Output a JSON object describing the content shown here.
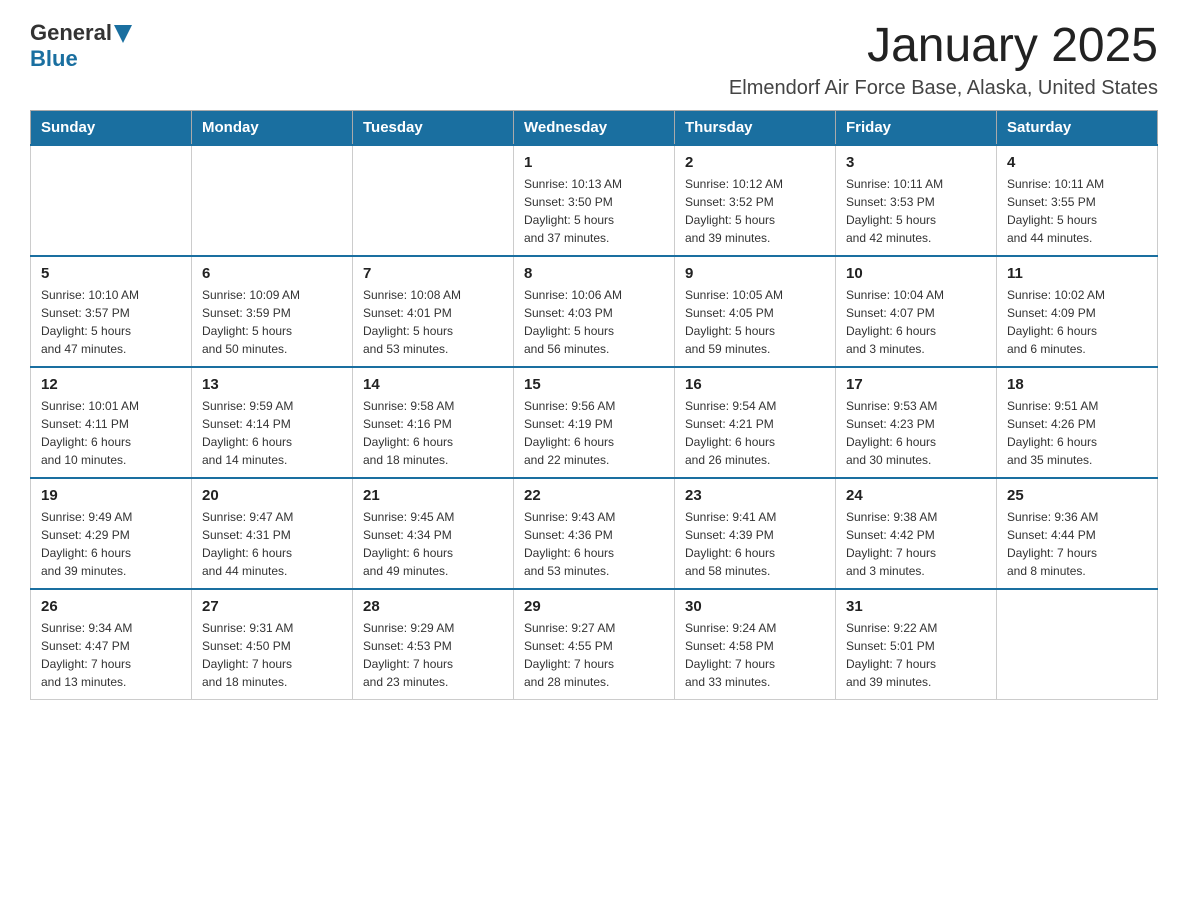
{
  "header": {
    "logo_general": "General",
    "logo_blue": "Blue",
    "month_title": "January 2025",
    "location": "Elmendorf Air Force Base, Alaska, United States"
  },
  "days_of_week": [
    "Sunday",
    "Monday",
    "Tuesday",
    "Wednesday",
    "Thursday",
    "Friday",
    "Saturday"
  ],
  "weeks": [
    [
      {
        "day": "",
        "info": ""
      },
      {
        "day": "",
        "info": ""
      },
      {
        "day": "",
        "info": ""
      },
      {
        "day": "1",
        "info": "Sunrise: 10:13 AM\nSunset: 3:50 PM\nDaylight: 5 hours\nand 37 minutes."
      },
      {
        "day": "2",
        "info": "Sunrise: 10:12 AM\nSunset: 3:52 PM\nDaylight: 5 hours\nand 39 minutes."
      },
      {
        "day": "3",
        "info": "Sunrise: 10:11 AM\nSunset: 3:53 PM\nDaylight: 5 hours\nand 42 minutes."
      },
      {
        "day": "4",
        "info": "Sunrise: 10:11 AM\nSunset: 3:55 PM\nDaylight: 5 hours\nand 44 minutes."
      }
    ],
    [
      {
        "day": "5",
        "info": "Sunrise: 10:10 AM\nSunset: 3:57 PM\nDaylight: 5 hours\nand 47 minutes."
      },
      {
        "day": "6",
        "info": "Sunrise: 10:09 AM\nSunset: 3:59 PM\nDaylight: 5 hours\nand 50 minutes."
      },
      {
        "day": "7",
        "info": "Sunrise: 10:08 AM\nSunset: 4:01 PM\nDaylight: 5 hours\nand 53 minutes."
      },
      {
        "day": "8",
        "info": "Sunrise: 10:06 AM\nSunset: 4:03 PM\nDaylight: 5 hours\nand 56 minutes."
      },
      {
        "day": "9",
        "info": "Sunrise: 10:05 AM\nSunset: 4:05 PM\nDaylight: 5 hours\nand 59 minutes."
      },
      {
        "day": "10",
        "info": "Sunrise: 10:04 AM\nSunset: 4:07 PM\nDaylight: 6 hours\nand 3 minutes."
      },
      {
        "day": "11",
        "info": "Sunrise: 10:02 AM\nSunset: 4:09 PM\nDaylight: 6 hours\nand 6 minutes."
      }
    ],
    [
      {
        "day": "12",
        "info": "Sunrise: 10:01 AM\nSunset: 4:11 PM\nDaylight: 6 hours\nand 10 minutes."
      },
      {
        "day": "13",
        "info": "Sunrise: 9:59 AM\nSunset: 4:14 PM\nDaylight: 6 hours\nand 14 minutes."
      },
      {
        "day": "14",
        "info": "Sunrise: 9:58 AM\nSunset: 4:16 PM\nDaylight: 6 hours\nand 18 minutes."
      },
      {
        "day": "15",
        "info": "Sunrise: 9:56 AM\nSunset: 4:19 PM\nDaylight: 6 hours\nand 22 minutes."
      },
      {
        "day": "16",
        "info": "Sunrise: 9:54 AM\nSunset: 4:21 PM\nDaylight: 6 hours\nand 26 minutes."
      },
      {
        "day": "17",
        "info": "Sunrise: 9:53 AM\nSunset: 4:23 PM\nDaylight: 6 hours\nand 30 minutes."
      },
      {
        "day": "18",
        "info": "Sunrise: 9:51 AM\nSunset: 4:26 PM\nDaylight: 6 hours\nand 35 minutes."
      }
    ],
    [
      {
        "day": "19",
        "info": "Sunrise: 9:49 AM\nSunset: 4:29 PM\nDaylight: 6 hours\nand 39 minutes."
      },
      {
        "day": "20",
        "info": "Sunrise: 9:47 AM\nSunset: 4:31 PM\nDaylight: 6 hours\nand 44 minutes."
      },
      {
        "day": "21",
        "info": "Sunrise: 9:45 AM\nSunset: 4:34 PM\nDaylight: 6 hours\nand 49 minutes."
      },
      {
        "day": "22",
        "info": "Sunrise: 9:43 AM\nSunset: 4:36 PM\nDaylight: 6 hours\nand 53 minutes."
      },
      {
        "day": "23",
        "info": "Sunrise: 9:41 AM\nSunset: 4:39 PM\nDaylight: 6 hours\nand 58 minutes."
      },
      {
        "day": "24",
        "info": "Sunrise: 9:38 AM\nSunset: 4:42 PM\nDaylight: 7 hours\nand 3 minutes."
      },
      {
        "day": "25",
        "info": "Sunrise: 9:36 AM\nSunset: 4:44 PM\nDaylight: 7 hours\nand 8 minutes."
      }
    ],
    [
      {
        "day": "26",
        "info": "Sunrise: 9:34 AM\nSunset: 4:47 PM\nDaylight: 7 hours\nand 13 minutes."
      },
      {
        "day": "27",
        "info": "Sunrise: 9:31 AM\nSunset: 4:50 PM\nDaylight: 7 hours\nand 18 minutes."
      },
      {
        "day": "28",
        "info": "Sunrise: 9:29 AM\nSunset: 4:53 PM\nDaylight: 7 hours\nand 23 minutes."
      },
      {
        "day": "29",
        "info": "Sunrise: 9:27 AM\nSunset: 4:55 PM\nDaylight: 7 hours\nand 28 minutes."
      },
      {
        "day": "30",
        "info": "Sunrise: 9:24 AM\nSunset: 4:58 PM\nDaylight: 7 hours\nand 33 minutes."
      },
      {
        "day": "31",
        "info": "Sunrise: 9:22 AM\nSunset: 5:01 PM\nDaylight: 7 hours\nand 39 minutes."
      },
      {
        "day": "",
        "info": ""
      }
    ]
  ]
}
